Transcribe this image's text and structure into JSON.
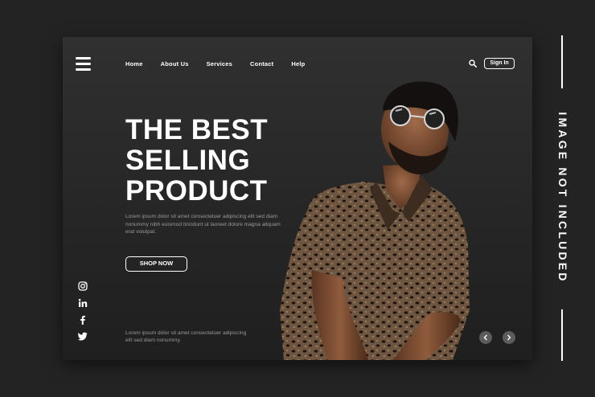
{
  "nav": {
    "items": [
      "Home",
      "About Us",
      "Services",
      "Contact",
      "Help"
    ],
    "sign_in_label": "Sign In"
  },
  "hero": {
    "title_lines": [
      "THE BEST",
      "SELLING",
      "PRODUCT"
    ],
    "body": "Lorem ipsum dolor sit amet consectetuer adipiscing elit sed diam nonummy nibh euismod tincidunt ut laoreet dolore magna aliquam erat volutpat.",
    "cta_label": "SHOP NOW"
  },
  "footer": {
    "text": "Lorem ipsum dolor sit amet consectetuer adipiscing elit sed diam nonummy."
  },
  "social": [
    "instagram-icon",
    "linkedin-icon",
    "facebook-icon",
    "twitter-icon"
  ],
  "side_label": "IMAGE NOT INCLUDED",
  "colors": {
    "background": "#232323",
    "card": "#2a2a2a",
    "text": "#ffffff",
    "muted_text": "#9a9a9a",
    "arrow_button": "#5c5c5c"
  }
}
